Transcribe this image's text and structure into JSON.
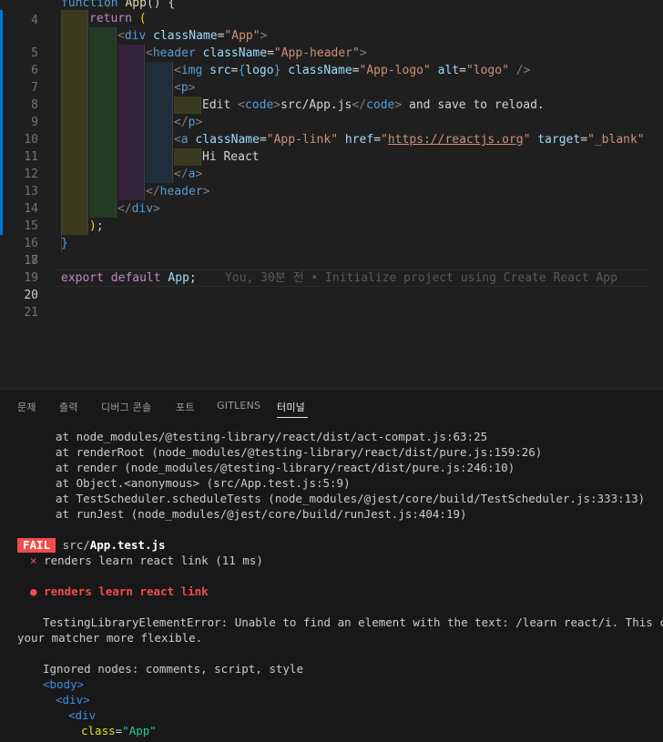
{
  "editor": {
    "line_numbers": [
      "4",
      "5",
      "6",
      "7",
      "8",
      "9",
      "10",
      "11",
      "12",
      "13",
      "14",
      "15",
      "16",
      "17",
      "18",
      "19",
      "20",
      "21"
    ],
    "active_line": "20",
    "lines": {
      "l4": {
        "kw": "function",
        "name": "App",
        "rest": "() {"
      },
      "l5": {
        "kw": "return",
        "paren": "("
      },
      "l6": {
        "open": "<",
        "tag": "div",
        "attr": "className",
        "eq": "=",
        "str": "\"App\"",
        "close": ">"
      },
      "l7": {
        "open": "<",
        "tag": "header",
        "attr": "className",
        "eq": "=",
        "str": "\"App-header\"",
        "close": ">"
      },
      "l8": {
        "open": "<",
        "tag": "img",
        "attr1": "src",
        "eq1": "=",
        "expr_open": "{",
        "expr": "logo",
        "expr_close": "}",
        "attr2": "className",
        "eq2": "=",
        "str2": "\"App-logo\"",
        "attr3": "alt",
        "eq3": "=",
        "str3": "\"logo\"",
        "close": " />"
      },
      "l9": {
        "open": "<",
        "tag": "p",
        "close": ">"
      },
      "l10": {
        "text1": "Edit ",
        "open": "<",
        "tag": "code",
        "close": ">",
        "text2": "src/App.js",
        "open2": "</",
        "tag2": "code",
        "close2": ">",
        "text3": " and save to reload."
      },
      "l11": {
        "open": "</",
        "tag": "p",
        "close": ">"
      },
      "l12": {
        "open": "<",
        "tag": "a",
        "attr1": "className",
        "eq1": "=",
        "str1": "\"App-link\"",
        "attr2": "href",
        "eq2": "=",
        "q1": "\"",
        "url": "https://reactjs.org",
        "q2": "\"",
        "attr3": "target",
        "eq3": "=",
        "str3": "\"_blank\""
      },
      "l13": {
        "text": "Hi React"
      },
      "l14": {
        "open": "</",
        "tag": "a",
        "close": ">"
      },
      "l15": {
        "open": "</",
        "tag": "header",
        "close": ">"
      },
      "l16": {
        "open": "</",
        "tag": "div",
        "close": ">"
      },
      "l17": {
        "paren": ")",
        "semi": ";"
      },
      "l18": {
        "brace": "}"
      },
      "l20": {
        "kw1": "export",
        "kw2": "default",
        "name": "App",
        "semi": ";",
        "blame": "You, 30분 전 • Initialize project using Create React App"
      }
    },
    "colors": {
      "added_bar": "#2ea043",
      "modified_bar": "#0078d4"
    }
  },
  "panel": {
    "tabs": [
      "문제",
      "출력",
      "디버그 콘솔",
      "포트",
      "GITLENS",
      "터미널"
    ],
    "active_tab": "터미널",
    "terminal": {
      "stack": [
        "at node_modules/@testing-library/react/dist/act-compat.js:63:25",
        "at renderRoot (node_modules/@testing-library/react/dist/pure.js:159:26)",
        "at render (node_modules/@testing-library/react/dist/pure.js:246:10)",
        "at Object.<anonymous> (src/App.test.js:5:9)",
        "at TestScheduler.scheduleTests (node_modules/@jest/core/build/TestScheduler.js:333:13)",
        "at runJest (node_modules/@jest/core/build/runJest.js:404:19)"
      ],
      "fail_badge": "FAIL",
      "fail_dir": "src/",
      "fail_file": "App.test.js",
      "test_line_mark": "×",
      "test_line_text": "renders learn react link (11 ms)",
      "bullet": "●",
      "test_title": "renders learn react link",
      "error_line1": "TestingLibraryElementError: Unable to find an element with the text: /learn react/i. This could be",
      "error_line2": "your matcher more flexible.",
      "ignored": "Ignored nodes: comments, script, style",
      "dom": {
        "body_open": "<body>",
        "div_open": "<div>",
        "div2_open": "<div",
        "class_attr": "class",
        "class_eq": "=",
        "class_val": "\"App\""
      }
    }
  }
}
